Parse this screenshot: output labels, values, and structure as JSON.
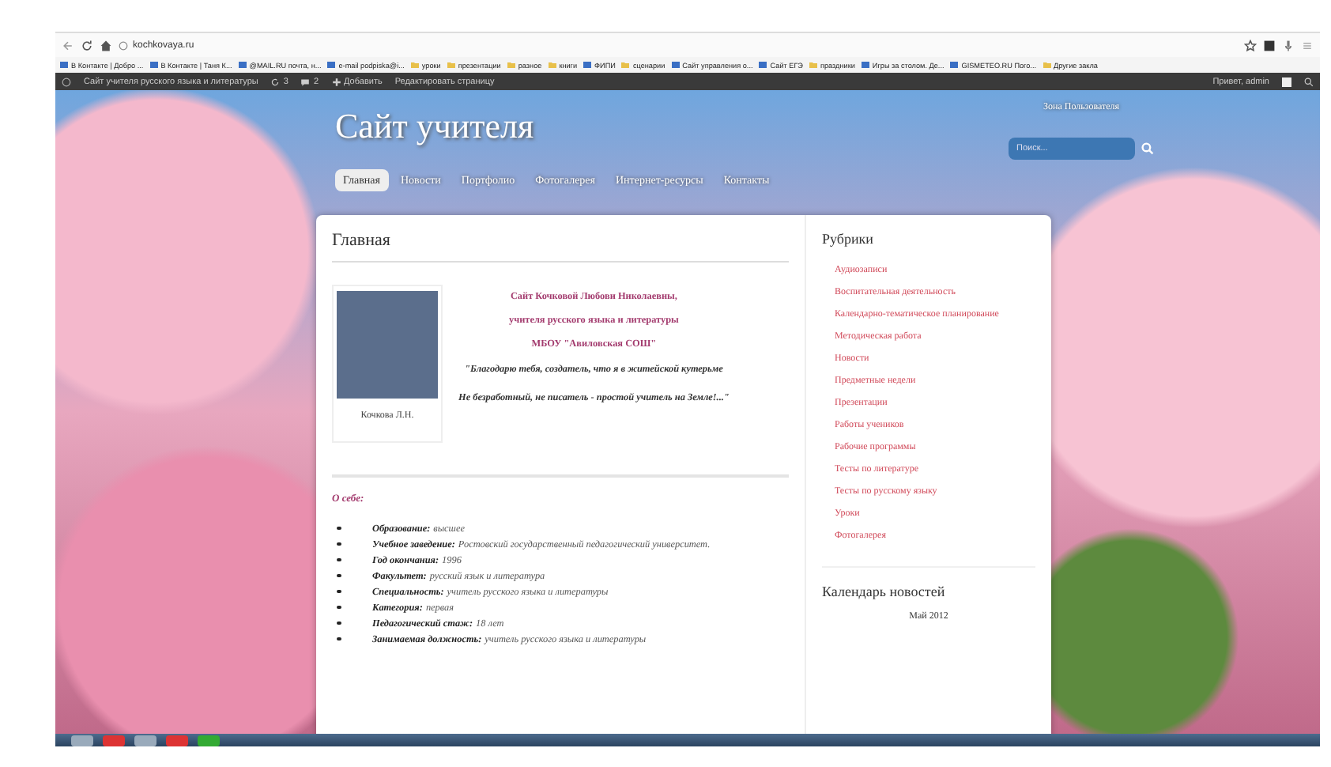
{
  "browser": {
    "url": "kochkovaya.ru",
    "bookmarks": [
      {
        "label": "В Контакте | Добро ...",
        "kind": "page"
      },
      {
        "label": "В Контакте | Таня К...",
        "kind": "page"
      },
      {
        "label": "@MAIL.RU почта, н...",
        "kind": "page"
      },
      {
        "label": "e-mail podpiska@i...",
        "kind": "page"
      },
      {
        "label": "уроки",
        "kind": "folder"
      },
      {
        "label": "презентации",
        "kind": "folder"
      },
      {
        "label": "разное",
        "kind": "folder"
      },
      {
        "label": "книги",
        "kind": "folder"
      },
      {
        "label": "ФИПИ",
        "kind": "page"
      },
      {
        "label": "сценарии",
        "kind": "folder"
      },
      {
        "label": "Сайт управления о...",
        "kind": "page"
      },
      {
        "label": "Сайт ЕГЭ",
        "kind": "page"
      },
      {
        "label": "праздники",
        "kind": "folder"
      },
      {
        "label": "Игры за столом. Де...",
        "kind": "page"
      },
      {
        "label": "GISMETEO.RU Пого...",
        "kind": "page"
      },
      {
        "label": "Другие закла",
        "kind": "folder"
      }
    ]
  },
  "admin_bar": {
    "site": "Сайт учителя русского языка и литературы",
    "updates": "3",
    "comments": "2",
    "add": "Добавить",
    "edit": "Редактировать страницу",
    "greeting": "Привет, admin"
  },
  "site": {
    "title": "Сайт учителя",
    "user_zone": "Зона Пользователя",
    "search": {
      "placeholder": "Поиск..."
    },
    "nav": [
      {
        "label": "Главная",
        "selected": true
      },
      {
        "label": "Новости",
        "selected": false
      },
      {
        "label": "Портфолио",
        "selected": false
      },
      {
        "label": "Фотогалерея",
        "selected": false
      },
      {
        "label": "Интернет-ресурсы",
        "selected": false
      },
      {
        "label": "Контакты",
        "selected": false
      }
    ]
  },
  "page": {
    "title": "Главная",
    "photo_caption": "Кочкова Л.Н.",
    "intro": [
      "Сайт Кочковой Любови Николаевны,",
      "учителя русского языка и литературы",
      "МБОУ \"Авиловская СОШ\""
    ],
    "quote": [
      "\"Благодарю тебя, создатель, что я в житейской кутерьме",
      "Не безработный, не писатель - простой учитель на Земле!...\""
    ],
    "about_heading": "О себе:",
    "about": [
      {
        "label": "Образование:",
        "value": "высшее"
      },
      {
        "label": "Учебное заведение:",
        "value": "Ростовский государственный педагогический университет."
      },
      {
        "label": "Год окончания:",
        "value": "1996"
      },
      {
        "label": "Факультет:",
        "value": "русский язык и литература"
      },
      {
        "label": "Специальность:",
        "value": "учитель русского языка и литературы"
      },
      {
        "label": "Категория:",
        "value": "первая"
      },
      {
        "label": "Педагогический стаж:",
        "value": "18 лет"
      },
      {
        "label": "Занимаемая должность:",
        "value": "учитель русского языка и литературы"
      }
    ]
  },
  "sidebar": {
    "categories_title": "Рубрики",
    "categories": [
      "Аудиозаписи",
      "Воспитательная деятельность",
      "Календарно-тематическое планирование",
      "Методическая работа",
      "Новости",
      "Предметные недели",
      "Презентации",
      "Работы учеников",
      "Рабочие программы",
      "Тесты по литературе",
      "Тесты по русскому языку",
      "Уроки",
      "Фотогалерея"
    ],
    "calendar_title": "Календарь новостей",
    "calendar_month": "Май 2012"
  }
}
